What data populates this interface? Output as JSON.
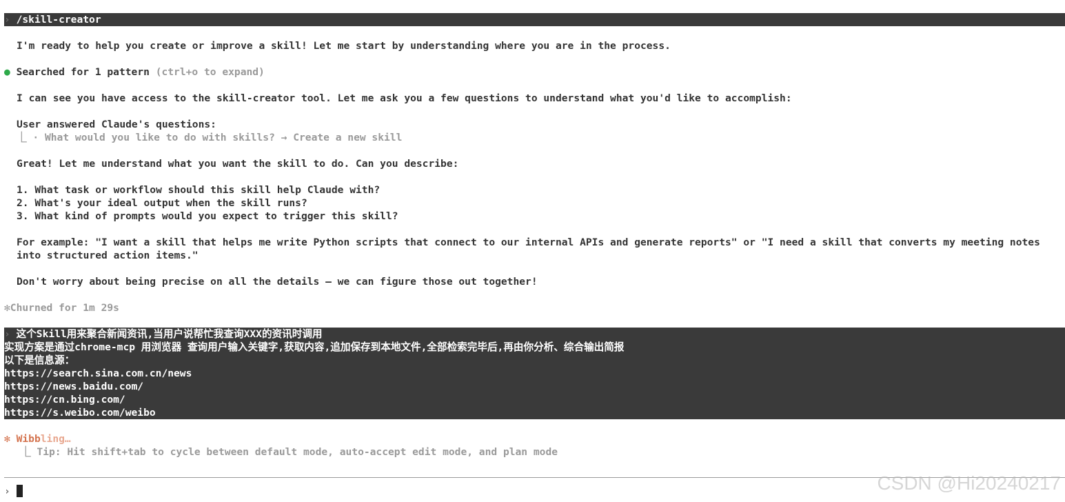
{
  "command": {
    "caret": "›",
    "text": "/skill-creator"
  },
  "messages": {
    "intro": "I'm ready to help you create or improve a skill! Let me start by understanding where you are in the process.",
    "tool_dot": "●",
    "tool_action": "Searched for 1 pattern",
    "tool_hint": "(ctrl+o to expand)",
    "access": "I can see you have access to the skill-creator tool. Let me ask you a few questions to understand what you'd like to accomplish:",
    "answered": "User answered Claude's questions:",
    "answer_branch": "⎿",
    "answer_detail": "· What would you like to do with skills? → Create a new skill",
    "great": "Great! Let me understand what you want the skill to do. Can you describe:",
    "q1": "1. What task or workflow should this skill help Claude with?",
    "q2": "2. What's your ideal output when the skill runs?",
    "q3": "3. What kind of prompts would you expect to trigger this skill?",
    "example_1": "For example: \"I want a skill that helps me write Python scripts that connect to our internal APIs and generate reports\" or \"I need a skill that converts my meeting notes",
    "example_2": "into structured action items.\"",
    "dont_worry": "Don't worry about being precise on all the details — we can figure those out together!",
    "churned_icon": "✻",
    "churned": "Churned for 1m 29s"
  },
  "user_input": {
    "caret": "›",
    "lines": [
      "这个Skill用来聚合新闻资讯,当用户说帮忙我查询XXX的资讯时调用",
      "实现方案是通过chrome-mcp 用浏览器 查询用户输入关键字,获取内容,追加保存到本地文件,全部检索完毕后,再由你分析、综合输出简报",
      "以下是信息源：",
      "https://search.sina.com.cn/news",
      "https://news.baidu.com/",
      "https://cn.bing.com/",
      "https://s.weibo.com/weibo"
    ]
  },
  "status": {
    "icon": "✻",
    "word_bright": "Wibb",
    "word_dim": "ling…",
    "tip_branch": "⎿",
    "tip": "Tip: Hit shift+tab to cycle between default mode, auto-accept edit mode, and plan mode"
  },
  "input": {
    "caret": "›"
  },
  "watermark": "CSDN @Hi20240217",
  "colors": {
    "command_bar": "#3a3a3a",
    "status_accent": "#d4734e",
    "tool_dot": "#2eaa4a",
    "dim_text": "#999999"
  }
}
